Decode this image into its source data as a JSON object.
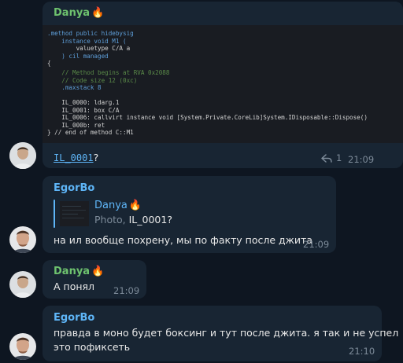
{
  "msg1": {
    "sender": "Danya",
    "sender_emoji": "🔥",
    "code": [
      ".method public hidebysig",
      "    instance void M1 (",
      "        valuetype C/A a",
      "    ) cil managed",
      "{",
      "    // Method begins at RVA 0x2088",
      "    // Code size 12 (0xc)",
      "    .maxstack 8",
      "",
      "    IL_0000: ldarg.1",
      "    IL_0001: box C/A",
      "    IL_0006: callvirt instance void [System.Private.CoreLib]System.IDisposable::Dispose()",
      "    IL_000b: ret",
      "} // end of method C::M1"
    ],
    "caption_code": "IL_0001",
    "caption_rest": "?",
    "reply_count": "1",
    "time": "21:09"
  },
  "msg2": {
    "sender": "EgorBo",
    "quote_sender": "Danya",
    "quote_emoji": "🔥",
    "quote_kind": "Photo, ",
    "quote_text": "IL_0001?",
    "text": "на ил вообще похрену, мы по факту после джита",
    "time": "21:09"
  },
  "msg3": {
    "sender": "Danya",
    "sender_emoji": "🔥",
    "text": "А понял",
    "time": "21:09"
  },
  "msg4": {
    "sender": "EgorBo",
    "text_line1": "правда в моно будет боксинг и тут после джита. я так и не успел",
    "text_line2": "это пофиксеть",
    "time": "21:10"
  },
  "colors": {
    "background": "#0e1621",
    "bubble": "#182533",
    "danya_name": "#6ec26e",
    "egorbo_name": "#5eb5f7",
    "code_bg": "#191c22"
  }
}
